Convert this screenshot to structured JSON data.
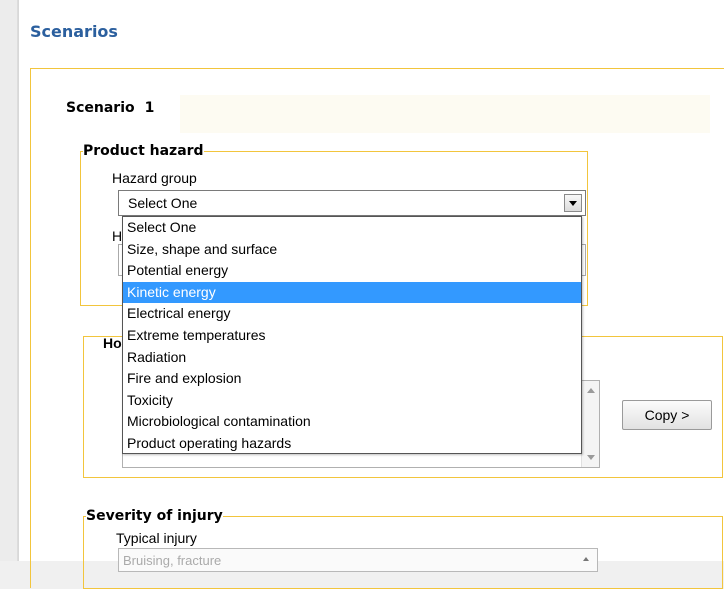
{
  "page": {
    "title": "Scenarios"
  },
  "scenario": {
    "label": "Scenario",
    "number": "1"
  },
  "product_hazard": {
    "legend": "Product hazard",
    "hazard_group_label": "Hazard group",
    "hazard_group_value": "Select One",
    "obscured_label_initial": "H",
    "dropdown": {
      "selected_index": 3,
      "options": [
        "Select One",
        "Size, shape and surface",
        "Potential energy",
        "Kinetic energy",
        "Electrical energy",
        "Extreme temperatures",
        "Radiation",
        "Fire and explosion",
        "Toxicity",
        "Microbiological contamination",
        "Product operating hazards"
      ]
    }
  },
  "hazard_section": {
    "legend_partial": "Ho"
  },
  "actions": {
    "copy_label": "Copy >"
  },
  "severity": {
    "legend": "Severity of injury",
    "typical_injury_label": "Typical injury",
    "typical_injury_value": "Bruising, fracture"
  },
  "colors": {
    "accent_border": "#f2c53d",
    "title_blue": "#2b5f9e",
    "selection_blue": "#3399ff"
  }
}
